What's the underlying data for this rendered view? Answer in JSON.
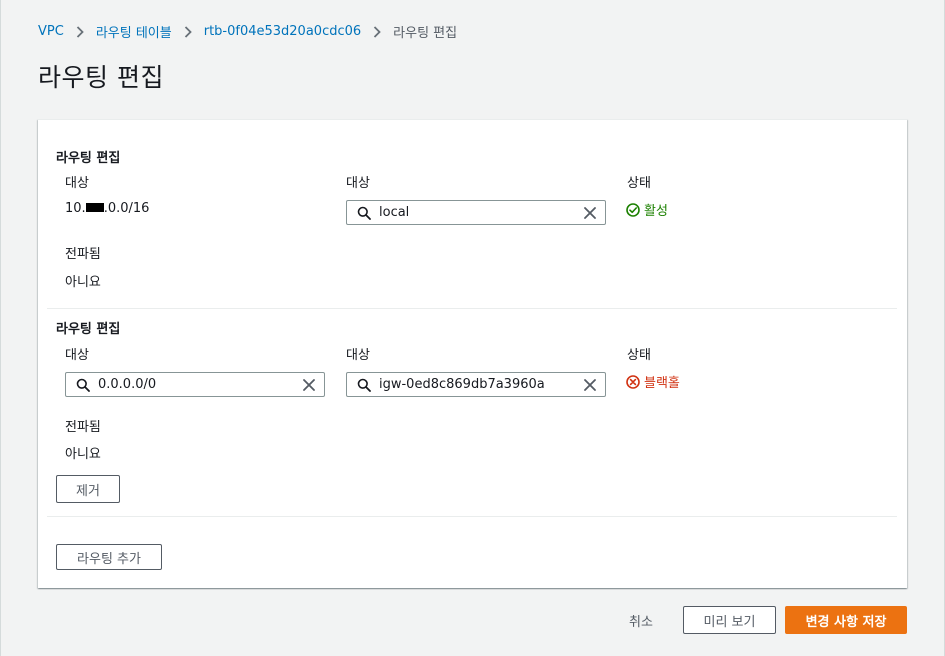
{
  "breadcrumb": {
    "items": [
      "VPC",
      "라우팅 테이블",
      "rtb-0f04e53d20a0cdc06"
    ],
    "current": "라우팅 편집"
  },
  "page_title": "라우팅 편집",
  "routes": [
    {
      "section_title": "라우팅 편집",
      "destination_label": "대상",
      "destination_prefix": "10.",
      "destination_suffix": ".0.0/16",
      "target_label": "대상",
      "target_value": "local",
      "status_label": "상태",
      "status_value": "활성",
      "propagated_label": "전파됨",
      "propagated_value": "아니요"
    },
    {
      "section_title": "라우팅 편집",
      "destination_label": "대상",
      "destination_value": "0.0.0.0/0",
      "target_label": "대상",
      "target_value": "igw-0ed8c869db7a3960a",
      "status_label": "상태",
      "status_value": "블랙홀",
      "propagated_label": "전파됨",
      "propagated_value": "아니요",
      "remove_label": "제거"
    }
  ],
  "add_route_label": "라우팅 추가",
  "footer": {
    "cancel_label": "취소",
    "preview_label": "미리 보기",
    "save_label": "변경 사항 저장"
  },
  "colors": {
    "link": "#0073bb",
    "active": "#1d8102",
    "blackhole": "#d13212",
    "primary": "#ec7211"
  },
  "icons": [
    "chevron-right-icon",
    "search-icon",
    "clear-icon",
    "status-ok-icon",
    "status-error-icon"
  ]
}
